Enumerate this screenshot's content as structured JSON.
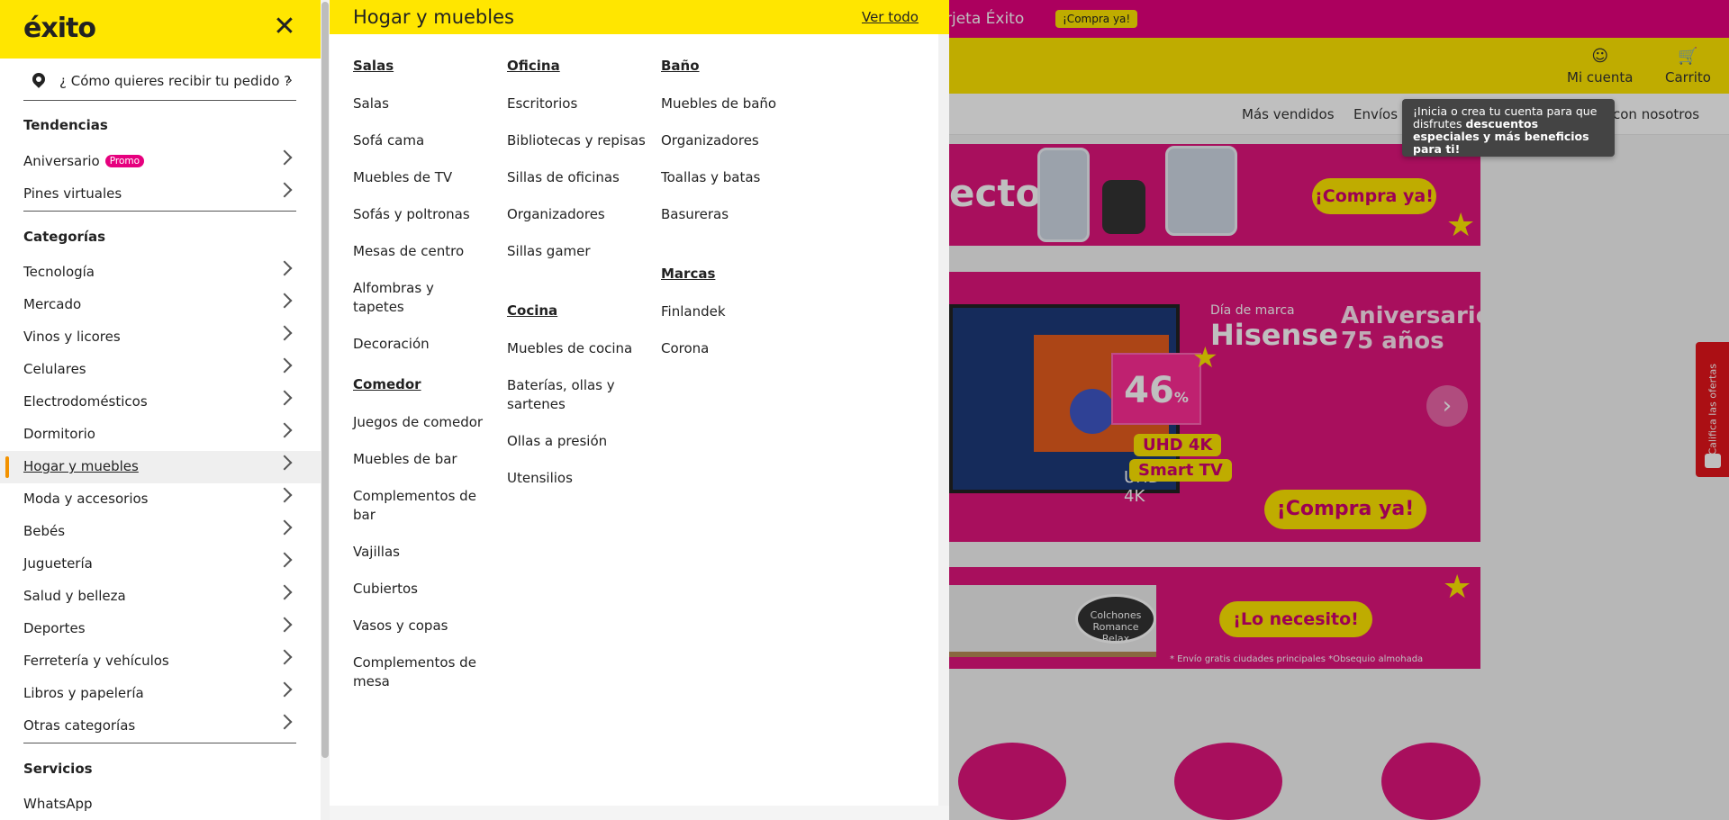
{
  "background": {
    "topbar": {
      "card_text": "rjeta Éxito",
      "compra_label": "¡Compra ya!"
    },
    "header": {
      "account_label": "Mi cuenta",
      "cart_label": "Carrito"
    },
    "nav": {
      "items": [
        "Más vendidos",
        "Envíos 2",
        "e con nosotros"
      ]
    },
    "tooltip": {
      "text_1": "¡Inicia o crea tu cuenta para que disfrutes ",
      "text_bold": "descuentos especiales y más beneficios para ti!"
    },
    "banner1": {
      "word": "ecto",
      "cta": "¡Compra ya!"
    },
    "banner2": {
      "brand_small": "Día de marca",
      "brand": "Hisense",
      "aniv_line1": "Aniversario",
      "aniv_line2": "75 años",
      "pct": "46",
      "pct_suffix": "% off",
      "tag1": "UHD 4K",
      "tag2": "Smart TV",
      "tv_label": "UHD 4K",
      "cta": "¡Compra ya!"
    },
    "banner3": {
      "logo": "Colchones Romance Relax",
      "cta": "¡Lo necesito!",
      "note": "* Envío gratis ciudades principales *Obsequio almohada"
    },
    "side_tab": "Califica las ofertas",
    "colors": {
      "brand_yellow": "#ffe600",
      "brand_pink": "#e6007e",
      "active_bar": "#f39200"
    }
  },
  "drawer": {
    "logo": "éxito",
    "close_icon": "close-icon",
    "delivery": "¿ Cómo quieres recibir tu pedido ?",
    "tendencias_title": "Tendencias",
    "tendencias": [
      {
        "label": "Aniversario",
        "badge": "Promo"
      },
      {
        "label": "Pines virtuales"
      }
    ],
    "categorias_title": "Categorías",
    "categorias": [
      {
        "label": "Tecnología"
      },
      {
        "label": "Mercado"
      },
      {
        "label": "Vinos y licores"
      },
      {
        "label": "Celulares"
      },
      {
        "label": "Electrodomésticos"
      },
      {
        "label": "Dormitorio"
      },
      {
        "label": "Hogar y muebles",
        "active": true
      },
      {
        "label": "Moda y accesorios"
      },
      {
        "label": "Bebés"
      },
      {
        "label": "Juguetería"
      },
      {
        "label": "Salud y belleza"
      },
      {
        "label": "Deportes"
      },
      {
        "label": "Ferretería y vehículos"
      },
      {
        "label": "Libros y papelería"
      },
      {
        "label": "Otras categorías"
      }
    ],
    "servicios_title": "Servicios",
    "servicios": [
      {
        "label": "WhatsApp"
      }
    ]
  },
  "panel": {
    "title": "Hogar y muebles",
    "ver_todo": "Ver todo",
    "columns": {
      "salas": {
        "title": "Salas",
        "links": [
          "Salas",
          "Sofá cama",
          "Muebles de TV",
          "Sofás y poltronas",
          "Mesas de centro",
          "Alfombras y tapetes",
          "Decoración"
        ]
      },
      "comedor": {
        "title": "Comedor",
        "links": [
          "Juegos de comedor",
          "Muebles de bar",
          "Complementos de bar",
          "Vajillas",
          "Cubiertos",
          "Vasos y copas",
          "Complementos de mesa"
        ]
      },
      "oficina": {
        "title": "Oficina",
        "links": [
          "Escritorios",
          "Bibliotecas y repisas",
          "Sillas de oficinas",
          "Organizadores",
          "Sillas gamer"
        ]
      },
      "cocina": {
        "title": "Cocina",
        "links": [
          "Muebles de cocina",
          "Baterías, ollas y sartenes",
          "Ollas a presión",
          "Utensilios"
        ]
      },
      "bano": {
        "title": "Baño",
        "links": [
          "Muebles de baño",
          "Organizadores",
          "Toallas y batas",
          "Basureras"
        ]
      },
      "marcas": {
        "title": "Marcas",
        "links": [
          "Finlandek",
          "Corona"
        ]
      }
    }
  }
}
